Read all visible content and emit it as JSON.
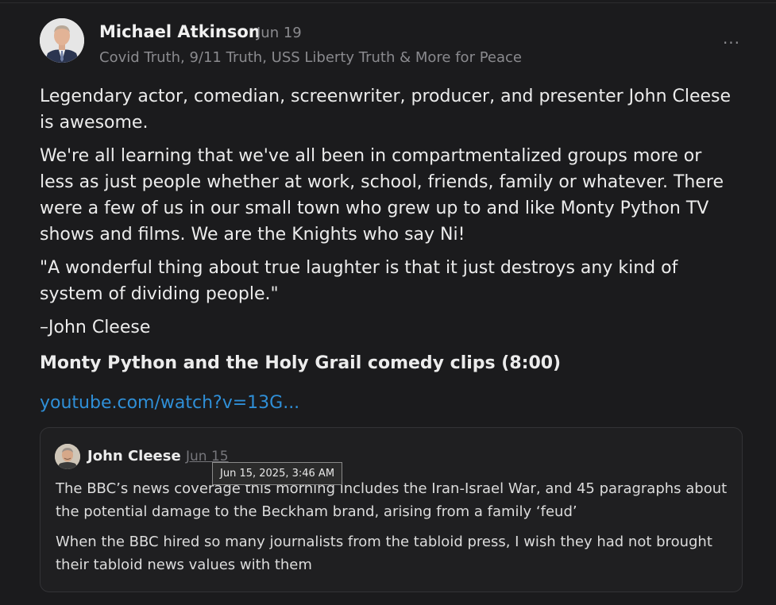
{
  "post": {
    "author_name": "Michael Atkinson",
    "date": "Jun 19",
    "author_bio": "Covid Truth, 9/11 Truth, USS Liberty Truth & More for Peace",
    "more_label": "···",
    "paragraphs": [
      "Legendary actor, comedian, screenwriter, producer, and presenter John Cleese is awesome.",
      "We're all learning that we've all been in compartmentalized groups more or less as just people whether at work, school, friends, family or whatever. There were a few of us in our small town who grew up to and like Monty Python TV shows and films. We are the Knights who say Ni!",
      "\"A wonderful thing about true laughter is that it just destroys any kind of system of dividing people.\"",
      "–John Cleese"
    ],
    "bold_line": "Monty Python and the Holy Grail comedy clips (8:00)",
    "link_text": "youtube.com/watch?v=13G..."
  },
  "quote": {
    "author_name": "John Cleese",
    "date": "Jun 15",
    "paragraphs": [
      "The BBC’s news coverage this morning includes the Iran-Israel War, and 45 paragraphs about the potential damage to the Beckham brand, arising from a family ‘feud’",
      "When the BBC hired so many journalists from the tabloid press, I wish they had not brought their tabloid news values with them"
    ]
  },
  "tooltip": {
    "text": "Jun 15, 2025, 3:46 AM"
  },
  "icons": {
    "author_avatar": "avatar-photo",
    "quote_avatar": "avatar-photo",
    "more": "more-horizontal-icon"
  },
  "colors": {
    "background": "#1b1b1d",
    "link": "#2f8fd7",
    "muted": "#8a8a8e"
  }
}
